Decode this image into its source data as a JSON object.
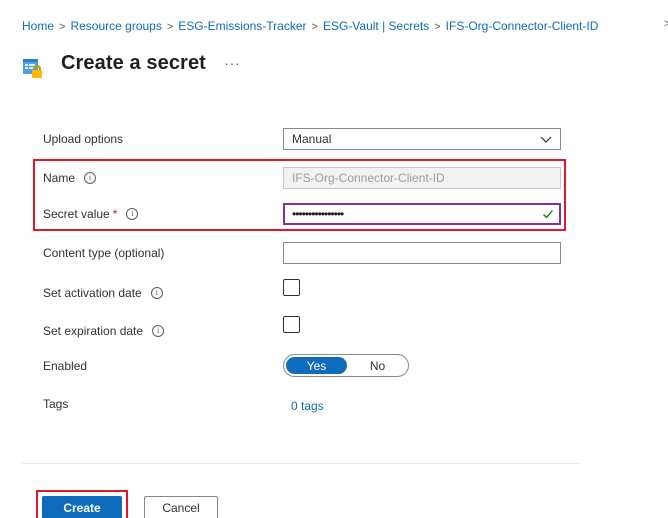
{
  "breadcrumb": {
    "items": [
      "Home",
      "Resource groups",
      "ESG-Emissions-Tracker",
      "ESG-Vault | Secrets",
      "IFS-Org-Connector-Client-ID"
    ],
    "separator": ">"
  },
  "header": {
    "title": "Create a secret",
    "more_label": "···",
    "icon": "key-vault-secret-icon"
  },
  "form": {
    "upload_options": {
      "label": "Upload options",
      "value": "Manual"
    },
    "name": {
      "label": "Name",
      "info": "i",
      "value": "IFS-Org-Connector-Client-ID"
    },
    "secret_value": {
      "label": "Secret value",
      "required_mark": "*",
      "info": "i",
      "value": "••••••••••••••••"
    },
    "content_type": {
      "label": "Content type (optional)",
      "value": ""
    },
    "activation_date": {
      "label": "Set activation date",
      "info": "i",
      "checked": false
    },
    "expiration_date": {
      "label": "Set expiration date",
      "info": "i",
      "checked": false
    },
    "enabled": {
      "label": "Enabled",
      "options": [
        "Yes",
        "No"
      ],
      "selected": "Yes"
    },
    "tags": {
      "label": "Tags",
      "link": "0 tags"
    }
  },
  "footer": {
    "create_label": "Create",
    "cancel_label": "Cancel"
  },
  "colors": {
    "accent": "#0f6cbd",
    "highlight": "#e3162b",
    "focus": "#8a2da5",
    "valid_check": "#107c10"
  }
}
